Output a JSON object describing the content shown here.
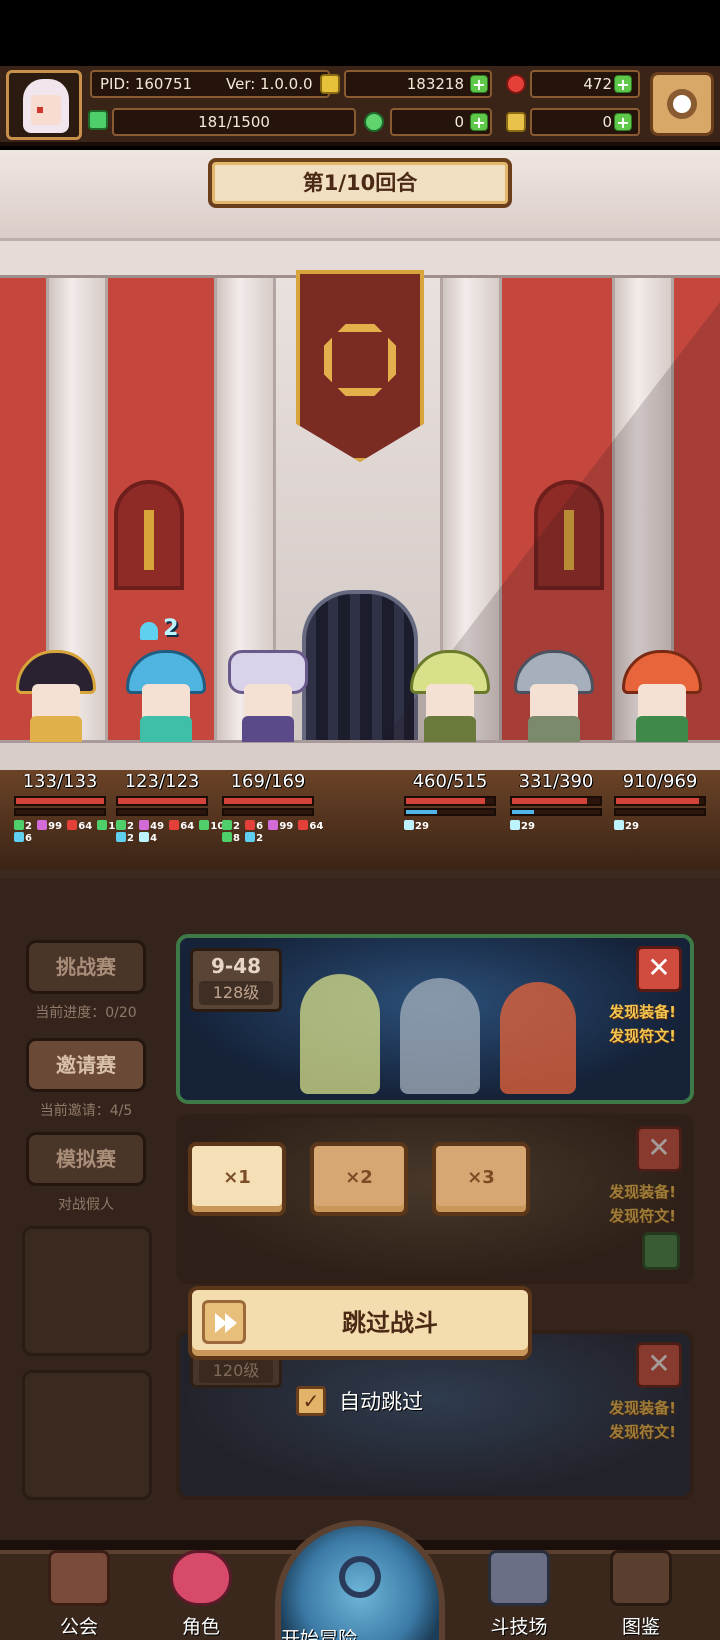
{
  "hud": {
    "pid_label": "PID: 160751",
    "version_label": "Ver: 1.0.0.0",
    "gold": "183218",
    "gems": "472",
    "energy": "181/1500",
    "clover": "0",
    "token": "0",
    "colors": {
      "accent": "#c8904a",
      "plus": "#5fc84a"
    }
  },
  "battle": {
    "round_label": "第1/10回合",
    "buff_count": "2",
    "heroes": [
      {
        "hp": "133/133",
        "hp_ratio": 1.0,
        "mp_ratio": 0.0,
        "stats": [
          "2",
          "99",
          "64",
          "10",
          "6"
        ]
      },
      {
        "hp": "123/123",
        "hp_ratio": 1.0,
        "mp_ratio": 0.0,
        "stats": [
          "2",
          "49",
          "64",
          "10",
          "2",
          "4"
        ]
      },
      {
        "hp": "169/169",
        "hp_ratio": 1.0,
        "mp_ratio": 0.0,
        "stats": [
          "2",
          "6",
          "99",
          "64",
          "8",
          "2"
        ]
      }
    ],
    "enemies": [
      {
        "hp": "460/515",
        "hp_ratio": 0.893,
        "mp_ratio": 0.35,
        "stats": [
          "29"
        ]
      },
      {
        "hp": "331/390",
        "hp_ratio": 0.849,
        "mp_ratio": 0.25,
        "stats": [
          "29"
        ]
      },
      {
        "hp": "910/969",
        "hp_ratio": 0.939,
        "mp_ratio": 0.0,
        "stats": [
          "29"
        ]
      }
    ]
  },
  "arena": {
    "side": [
      {
        "label": "挑战赛",
        "caption": "当前进度：0/20"
      },
      {
        "label": "邀请赛",
        "caption": "当前邀请：4/5"
      },
      {
        "label": "模拟赛",
        "caption": "对战假人"
      }
    ],
    "cards": [
      {
        "stage": "9-48",
        "level": "128级",
        "found_equip": "发现装备!",
        "found_rune": "发现符文!"
      },
      {
        "found_equip": "发现装备!",
        "found_rune": "发现符文!"
      },
      {
        "level": "120级",
        "found_equip": "发现装备!",
        "found_rune": "发现符文!"
      }
    ],
    "close_glyph": "✕",
    "speeds": [
      "×1",
      "×2",
      "×3"
    ],
    "skip_label": "跳过战斗",
    "auto_skip_label": "自动跳过",
    "auto_skip_checked": true
  },
  "nav": {
    "items": [
      "公会",
      "角色",
      "开始冒险",
      "斗技场",
      "图鉴"
    ]
  }
}
